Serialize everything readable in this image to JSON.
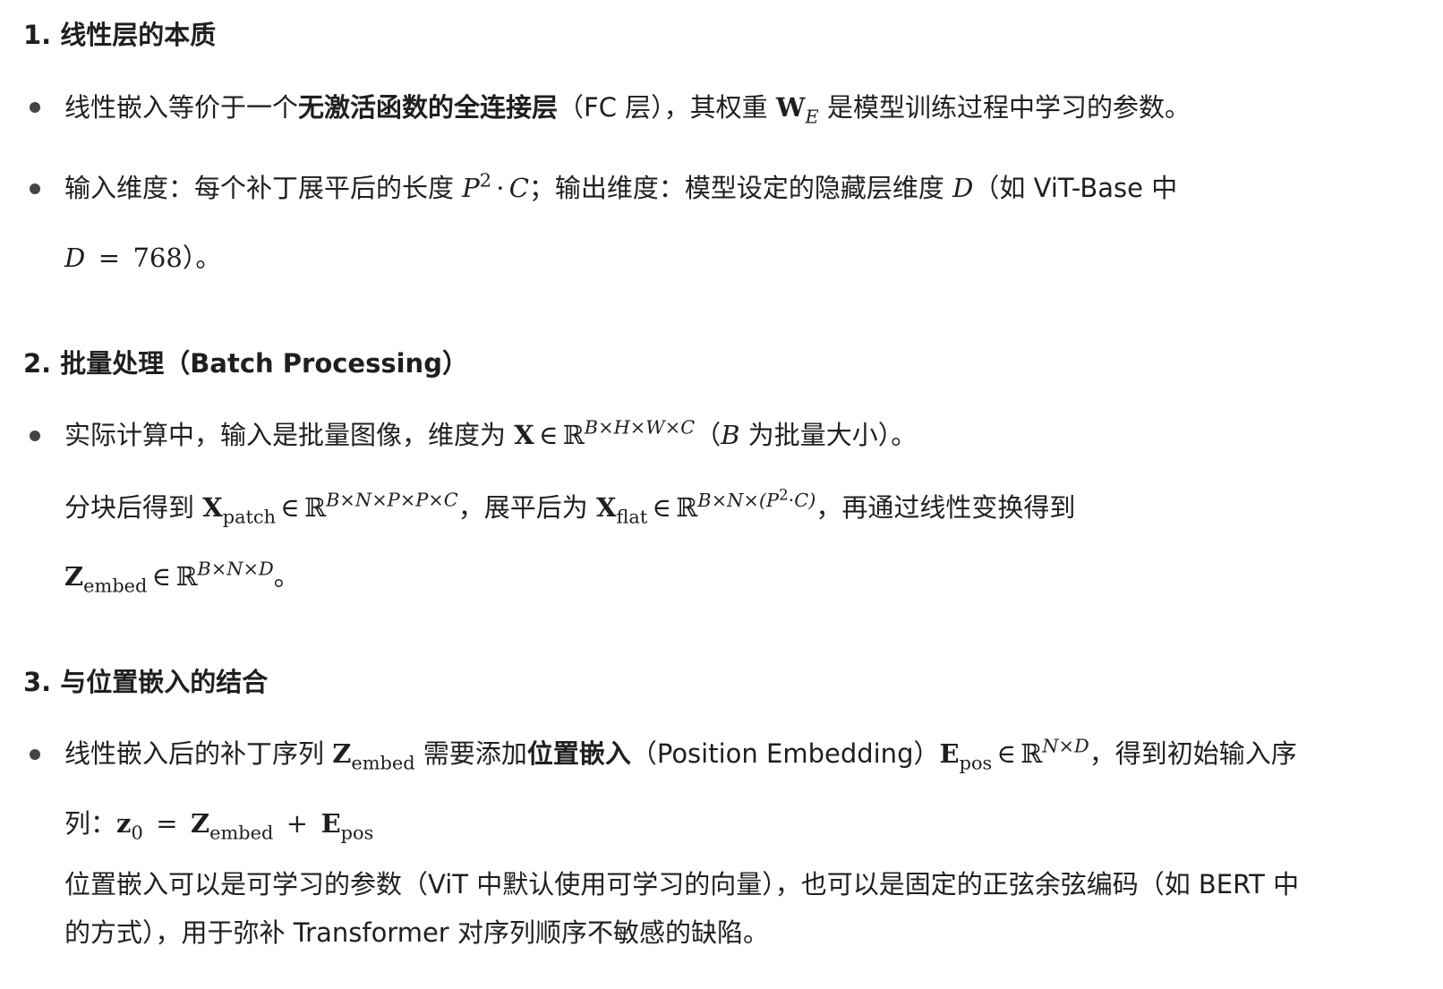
{
  "section1": {
    "title": "1. 线性层的本质",
    "b1": {
      "t1": "线性嵌入等价于一个",
      "bold": "无激活函数的全连接层",
      "t2": "（FC 层），其权重 ",
      "t3": " 是模型训练过程中学习的参数。"
    },
    "b2": {
      "t1": "输入维度：每个补丁展平后的长度 ",
      "t2": "；输出维度：模型设定的隐藏层维度 ",
      "t3": "（如 ViT-Base 中",
      "t4": "）。"
    }
  },
  "section2": {
    "title": "2. 批量处理（Batch Processing）",
    "b1": {
      "t1": "实际计算中，输入是批量图像，维度为 ",
      "t2": "（",
      "t3": " 为批量大小）。"
    },
    "p1": {
      "t1": "分块后得到 ",
      "t2": "，展平后为 ",
      "t3": "，再通过线性变换得到"
    },
    "p2": {
      "t1": "。"
    }
  },
  "section3": {
    "title": "3. 与位置嵌入的结合",
    "b1": {
      "t1": "线性嵌入后的补丁序列 ",
      "t2": " 需要添加",
      "bold": "位置嵌入",
      "t3": "（Position Embedding）",
      "t4": "，得到初始输入序",
      "t5": "列："
    },
    "p1": "位置嵌入可以是可学习的参数（ViT 中默认使用可学习的向量），也可以是固定的正弦余弦编码（如 BERT 中",
    "p2": "的方式），用于弥补 Transformer 对序列顺序不敏感的缺陷。"
  }
}
